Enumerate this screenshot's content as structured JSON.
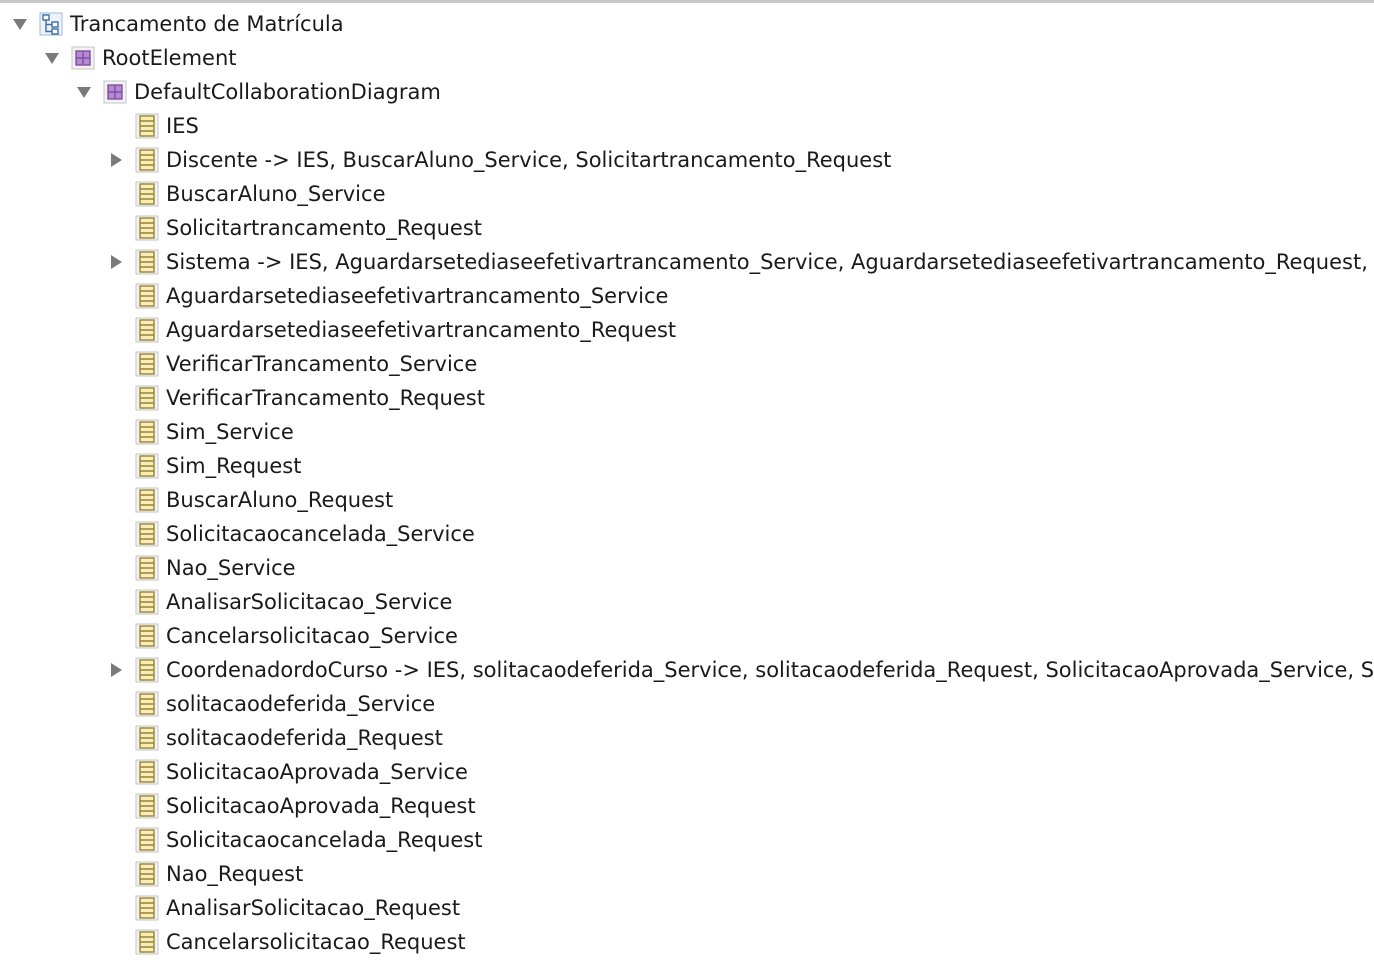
{
  "tree": {
    "root": {
      "label": "Trancamento de Matrícula",
      "icon": "hierarchy-icon",
      "expanded": true
    },
    "root_element": {
      "label": "RootElement",
      "icon": "element-icon",
      "expanded": true
    },
    "diagram": {
      "label": "DefaultCollaborationDiagram",
      "icon": "element-icon",
      "expanded": true
    },
    "items": [
      {
        "label": "IES",
        "expandable": false
      },
      {
        "label": "Discente -> IES, BuscarAluno_Service, Solicitartrancamento_Request",
        "expandable": true
      },
      {
        "label": "BuscarAluno_Service",
        "expandable": false
      },
      {
        "label": "Solicitartrancamento_Request",
        "expandable": false
      },
      {
        "label": "Sistema -> IES, Aguardarsetediaseefetivartrancamento_Service, Aguardarsetediaseefetivartrancamento_Request, V",
        "expandable": true
      },
      {
        "label": "Aguardarsetediaseefetivartrancamento_Service",
        "expandable": false
      },
      {
        "label": "Aguardarsetediaseefetivartrancamento_Request",
        "expandable": false
      },
      {
        "label": "VerificarTrancamento_Service",
        "expandable": false
      },
      {
        "label": "VerificarTrancamento_Request",
        "expandable": false
      },
      {
        "label": "Sim_Service",
        "expandable": false
      },
      {
        "label": "Sim_Request",
        "expandable": false
      },
      {
        "label": "BuscarAluno_Request",
        "expandable": false
      },
      {
        "label": "Solicitacaocancelada_Service",
        "expandable": false
      },
      {
        "label": "Nao_Service",
        "expandable": false
      },
      {
        "label": "AnalisarSolicitacao_Service",
        "expandable": false
      },
      {
        "label": "Cancelarsolicitacao_Service",
        "expandable": false
      },
      {
        "label": "CoordenadordoCurso -> IES, solitacaodeferida_Service, solitacaodeferida_Request, SolicitacaoAprovada_Service, S",
        "expandable": true
      },
      {
        "label": "solitacaodeferida_Service",
        "expandable": false
      },
      {
        "label": "solitacaodeferida_Request",
        "expandable": false
      },
      {
        "label": "SolicitacaoAprovada_Service",
        "expandable": false
      },
      {
        "label": "SolicitacaoAprovada_Request",
        "expandable": false
      },
      {
        "label": "Solicitacaocancelada_Request",
        "expandable": false
      },
      {
        "label": "Nao_Request",
        "expandable": false
      },
      {
        "label": "AnalisarSolicitacao_Request",
        "expandable": false
      },
      {
        "label": "Cancelarsolicitacao_Request",
        "expandable": false
      }
    ]
  },
  "colors": {
    "twisty": "#7a7a7a",
    "element_fill": "#b58ad1",
    "element_stroke": "#7d4ea3",
    "lifeline_fill": "#f6eebb",
    "lifeline_stroke": "#9a8430",
    "hierarchy_stroke": "#3b6ea8"
  }
}
